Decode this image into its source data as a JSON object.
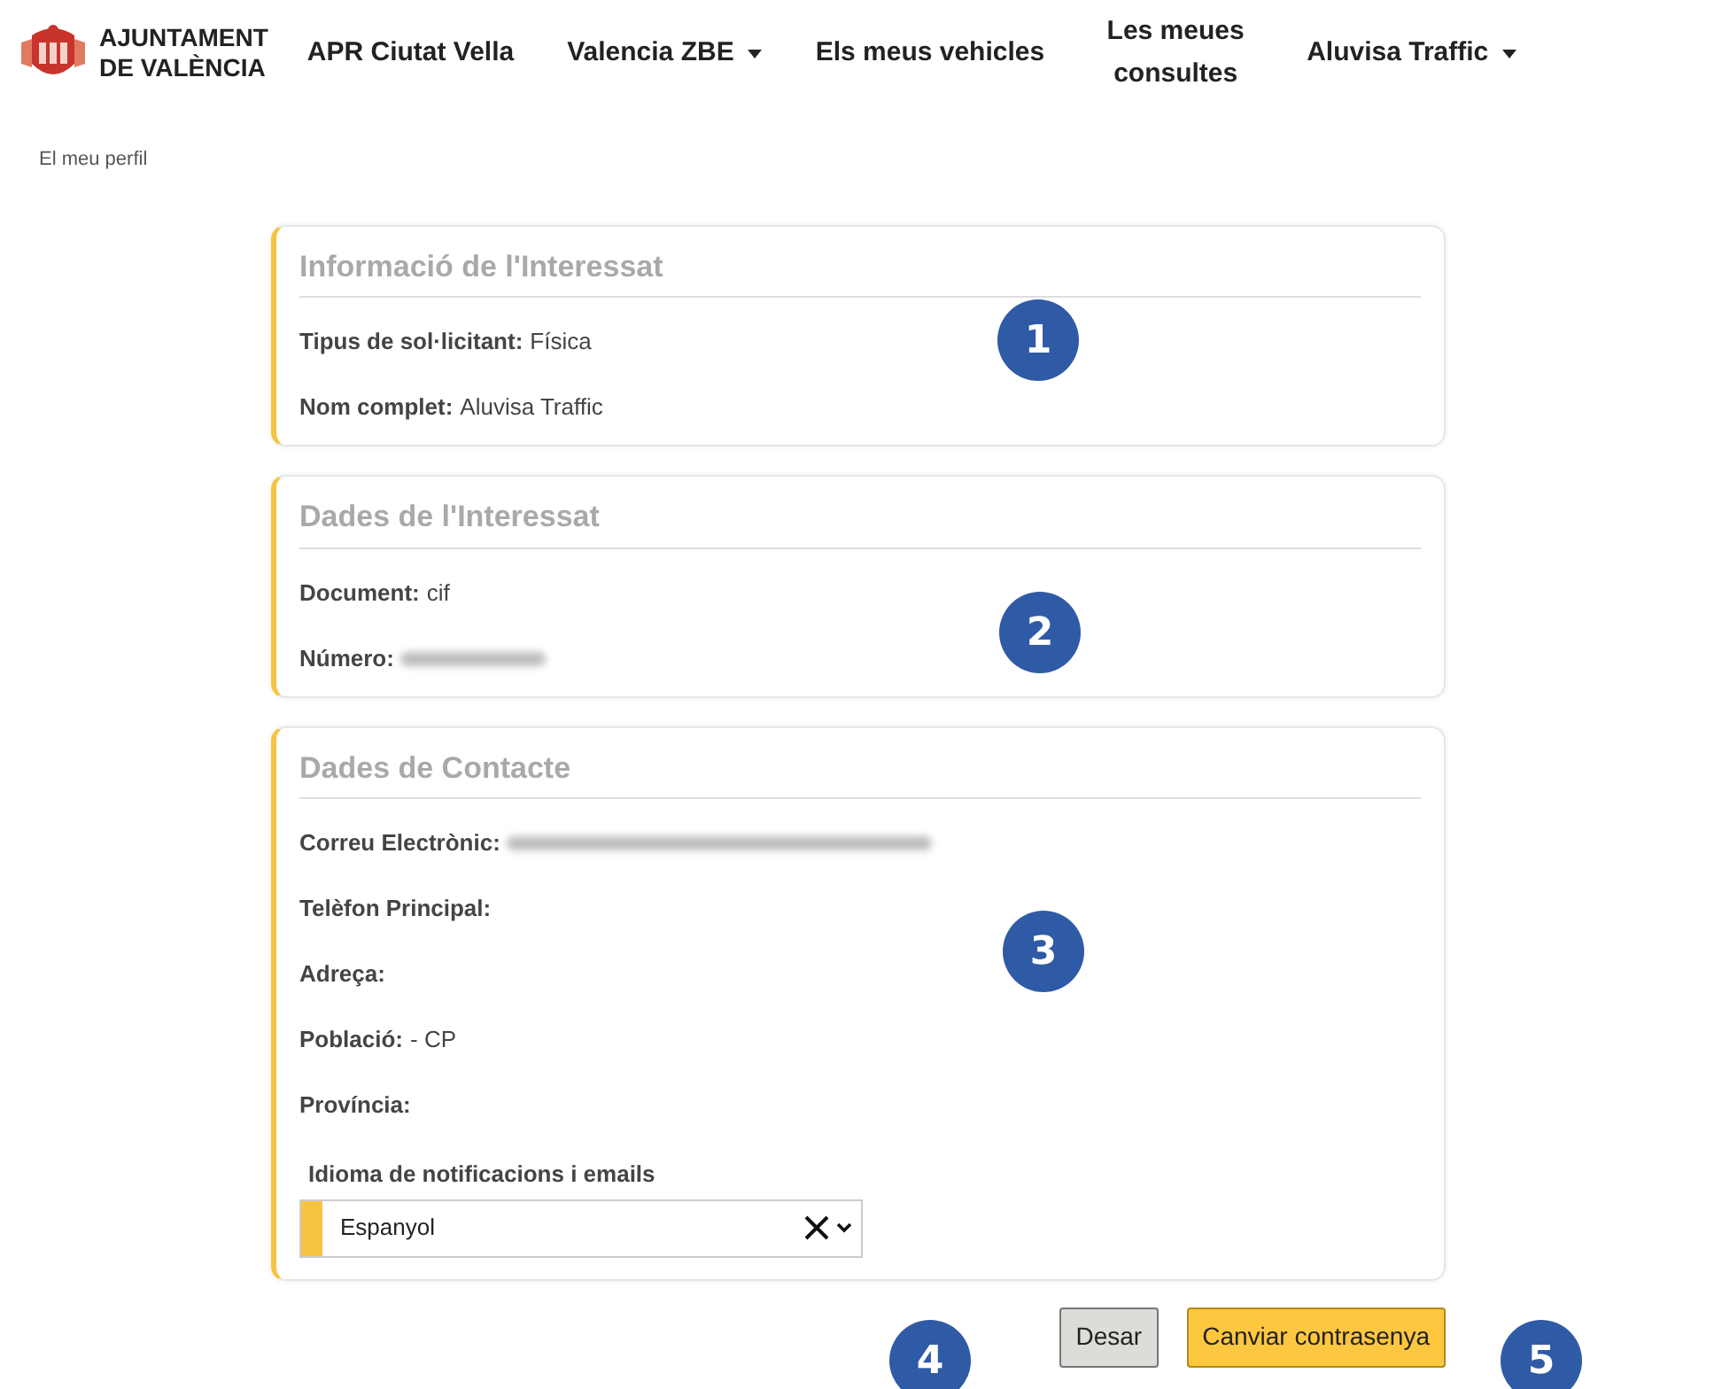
{
  "header": {
    "logo": [
      "AJUNTAMENT",
      "DE VALÈNCIA"
    ],
    "nav": [
      {
        "label": "APR Ciutat Vella",
        "dropdown": false
      },
      {
        "label": "Valencia ZBE",
        "dropdown": true
      },
      {
        "label": "Els meus vehicles",
        "dropdown": false
      },
      {
        "label": "Les meues consultes",
        "dropdown": false
      },
      {
        "label": "Aluvisa Traffic",
        "dropdown": true
      }
    ]
  },
  "breadcrumb": "El meu perfil",
  "sections": [
    {
      "title": "Informació de l'Interessat",
      "fields": [
        {
          "label": "Tipus de sol·licitant:",
          "value": "Física",
          "redacted": false
        },
        {
          "label": "Nom complet:",
          "value": "Aluvisa Traffic",
          "redacted": false
        }
      ]
    },
    {
      "title": "Dades de l'Interessat",
      "fields": [
        {
          "label": "Document:",
          "value": "cif",
          "redacted": false
        },
        {
          "label": "Número:",
          "redacted": true
        }
      ]
    },
    {
      "title": "Dades de Contacte",
      "fields": [
        {
          "label": "Correu Electrònic:",
          "redacted": true
        },
        {
          "label": "Telèfon Principal:",
          "redacted": false
        },
        {
          "label": "Adreça:",
          "redacted": false
        },
        {
          "label": "Població:",
          "value": "- CP",
          "redacted": false
        },
        {
          "label": "Província:",
          "redacted": false
        }
      ],
      "select": {
        "label": "Idioma de notificacions i emails",
        "value": "Espanyol"
      }
    }
  ],
  "buttons": [
    {
      "label": "Desar",
      "kind": "secondary"
    },
    {
      "label": "Canviar contrasenya",
      "kind": "primary"
    }
  ],
  "callouts": [
    "1",
    "2",
    "3",
    "4",
    "5"
  ]
}
